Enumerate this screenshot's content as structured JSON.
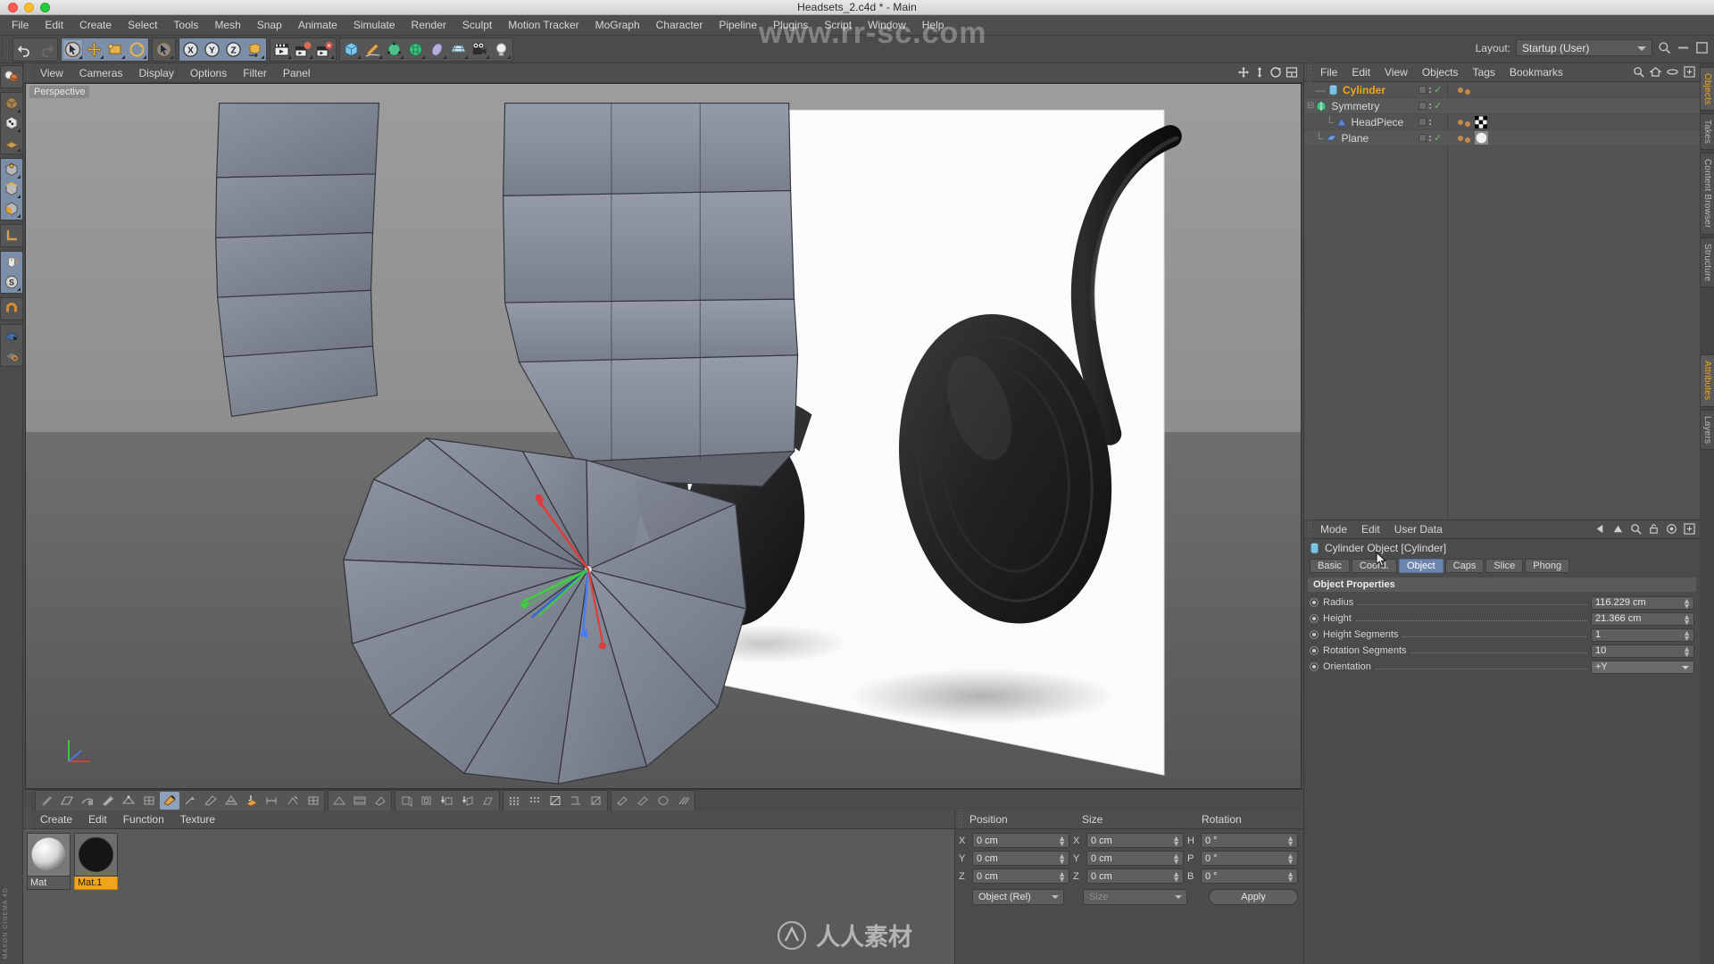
{
  "window": {
    "title": "Headsets_2.c4d * - Main"
  },
  "menubar": {
    "items": [
      "File",
      "Edit",
      "Create",
      "Select",
      "Tools",
      "Mesh",
      "Snap",
      "Animate",
      "Simulate",
      "Render",
      "Sculpt",
      "Motion Tracker",
      "MoGraph",
      "Character",
      "Pipeline",
      "Plugins",
      "Script",
      "Window",
      "Help"
    ]
  },
  "toolbar": {
    "layout_label": "Layout:",
    "layout_value": "Startup (User)",
    "groups": [
      {
        "name": "history",
        "buttons": [
          "undo-icon",
          "redo-icon"
        ]
      },
      {
        "name": "tools",
        "buttons": [
          "select-tool-icon",
          "move-tool-icon",
          "scale-tool-icon",
          "rotate-tool-icon"
        ]
      },
      {
        "name": "live-select",
        "buttons": [
          "live-selection-icon"
        ]
      },
      {
        "name": "axis-locks",
        "buttons": [
          "axis-x-icon",
          "axis-y-icon",
          "axis-z-icon",
          "world-object-axis-icon"
        ]
      },
      {
        "name": "render",
        "buttons": [
          "render-view-icon",
          "render-region-icon",
          "render-settings-icon"
        ]
      },
      {
        "name": "primitives",
        "buttons": [
          "cube-primitive-icon",
          "spline-pen-icon",
          "nurbs-icon",
          "deformer-icon",
          "environment-icon",
          "scene-icon",
          "camera-icon",
          "light-icon"
        ]
      }
    ]
  },
  "left_toolbar": {
    "buttons": [
      "undo-redo-icon",
      "make-editable-icon",
      "texture-axis-icon",
      "enable-axis-icon",
      "point-mode-icon",
      "edge-mode-icon",
      "polygon-mode-icon",
      "workplane-icon",
      "mouse-tool-icon",
      "snap-toggle-icon",
      "magnet-icon",
      "workplane-lock-icon",
      "workplane-rotate-icon"
    ]
  },
  "viewport": {
    "menu": [
      "View",
      "Cameras",
      "Display",
      "Options",
      "Filter",
      "Panel"
    ],
    "label": "Perspective",
    "nav_icons": [
      "pan-icon",
      "dolly-icon",
      "orbit-icon",
      "maximize-icon"
    ]
  },
  "mode_toolbar": {
    "groups": [
      [
        "knife-icon",
        "bridge-icon",
        "brush-icon",
        "close-polygon-hole-icon",
        "create-point-icon",
        "iron-icon",
        "magnet-tool-icon",
        "mirror-icon",
        "set-point-value-icon",
        "slide-icon",
        "smooth-shift-icon",
        "spin-edge-icon",
        "weld-icon"
      ],
      [
        "extrude-icon",
        "extrude-inner-icon",
        "bevel-icon"
      ],
      [
        "matrix-extrude-icon",
        "normal-move-icon",
        "normal-rotate-icon",
        "normal-scale-icon"
      ],
      [
        "subdivide-icon"
      ],
      [
        "array-icon",
        "clone-icon",
        "disconnect-icon",
        "split-icon",
        "triangulate-icon"
      ],
      [
        "untriangulate-icon",
        "optimize-icon",
        "reverse-normals-icon",
        "align-normals-icon"
      ]
    ]
  },
  "object_manager": {
    "menu": [
      "File",
      "Edit",
      "View",
      "Objects",
      "Tags",
      "Bookmarks"
    ],
    "header_icons": [
      "search-icon",
      "home-icon",
      "layers-icon",
      "expand-icon"
    ],
    "tab_label": "Objects",
    "items": [
      {
        "name": "Cylinder",
        "selected": true,
        "indent": 1,
        "icon": "cylinder-icon",
        "visible_check": true,
        "tags": 2,
        "material_tag": "none"
      },
      {
        "name": "Symmetry",
        "selected": false,
        "indent": 0,
        "icon": "symmetry-icon",
        "visible_check": true,
        "tags": 0,
        "material_tag": "none",
        "expander": true
      },
      {
        "name": "HeadPiece",
        "selected": false,
        "indent": 2,
        "icon": "headpiece-icon",
        "visible_check": false,
        "tags": 2,
        "material_tag": "checker"
      },
      {
        "name": "Plane",
        "selected": false,
        "indent": 1,
        "icon": "plane-icon",
        "visible_check": true,
        "tags": 2,
        "material_tag": "white-sphere"
      }
    ]
  },
  "attribute_manager": {
    "menu": [
      "Mode",
      "Edit",
      "User Data"
    ],
    "header_icons": [
      "back-arrow-icon",
      "up-arrow-icon",
      "search-icon",
      "lock-icon",
      "target-icon",
      "expand-icon"
    ],
    "object_title": "Cylinder Object [Cylinder]",
    "tabs": [
      "Basic",
      "Coord.",
      "Object",
      "Caps",
      "Slice",
      "Phong"
    ],
    "active_tab": "Object",
    "section_title": "Object Properties",
    "properties": [
      {
        "label": "Radius",
        "value": "116.229 cm",
        "type": "number"
      },
      {
        "label": "Height",
        "value": "21.366 cm",
        "type": "number"
      },
      {
        "label": "Height Segments",
        "value": "1",
        "type": "number"
      },
      {
        "label": "Rotation Segments",
        "value": "10",
        "type": "number"
      },
      {
        "label": "Orientation",
        "value": "+Y",
        "type": "dropdown"
      }
    ]
  },
  "material_manager": {
    "menu": [
      "Create",
      "Edit",
      "Function",
      "Texture"
    ],
    "materials": [
      {
        "name": "Mat",
        "selected": false
      },
      {
        "name": "Mat.1",
        "selected": true
      }
    ]
  },
  "coordinates": {
    "columns": [
      "Position",
      "Size",
      "Rotation"
    ],
    "rows": [
      {
        "pos_label": "X",
        "pos_value": "0 cm",
        "size_label": "X",
        "size_value": "0 cm",
        "rot_label": "H",
        "rot_value": "0 °"
      },
      {
        "pos_label": "Y",
        "pos_value": "0 cm",
        "size_label": "Y",
        "size_value": "0 cm",
        "rot_label": "P",
        "rot_value": "0 °"
      },
      {
        "pos_label": "Z",
        "pos_value": "0 cm",
        "size_label": "Z",
        "size_value": "0 cm",
        "rot_label": "B",
        "rot_value": "0 °"
      }
    ],
    "mode_select": "Object (Rel)",
    "size_select": "Size",
    "apply_label": "Apply"
  },
  "edge_tabs_top": [
    "Objects",
    "Takes",
    "Content Browser",
    "Structure"
  ],
  "edge_tabs_bottom": [
    "Attributes",
    "Layers"
  ],
  "watermarks": {
    "top": "www.rr-sc.com",
    "bottom": "人人素材"
  },
  "colors": {
    "accent": "#f3a51a",
    "tab_active": "#6e86ad",
    "panel": "#4b4b4b",
    "field": "#5e5e5e"
  }
}
